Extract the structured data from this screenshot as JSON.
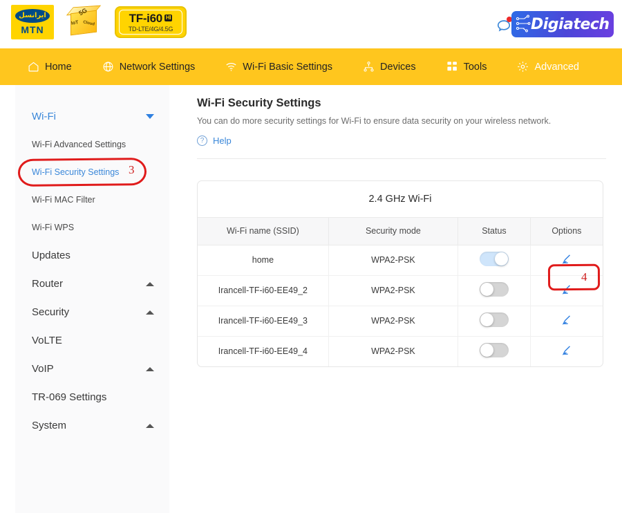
{
  "brand": {
    "irancell_fa": "ایرانسل",
    "mtn": "MTN",
    "cube": {
      "g5": "5G",
      "iot": "IoT",
      "cloud": "Cloud"
    },
    "device_model": "TF-i60",
    "device_badge": "HI",
    "device_tech": "TD-LTE/4G/4.5G",
    "vendor": "Digiatech",
    "chat_icon": "chat-bubble-icon",
    "chat_badge_icon": "notification-dot-icon"
  },
  "nav": {
    "items": [
      {
        "label": "Home",
        "icon": "home-icon",
        "active": false
      },
      {
        "label": "Network Settings",
        "icon": "globe-icon",
        "active": false
      },
      {
        "label": "Wi-Fi Basic Settings",
        "icon": "wifi-icon",
        "active": false
      },
      {
        "label": "Devices",
        "icon": "devices-tree-icon",
        "active": false
      },
      {
        "label": "Tools",
        "icon": "grid-squares-icon",
        "active": false
      },
      {
        "label": "Advanced",
        "icon": "gear-icon",
        "active": true
      }
    ]
  },
  "sidebar": {
    "groups": [
      {
        "label": "Wi-Fi",
        "expanded": true,
        "caret": "chevron-down-icon",
        "children": [
          {
            "label": "Wi-Fi Advanced Settings",
            "active": false
          },
          {
            "label": "Wi-Fi Security Settings",
            "active": true
          },
          {
            "label": "Wi-Fi MAC Filter",
            "active": false
          },
          {
            "label": "Wi-Fi WPS",
            "active": false
          }
        ]
      },
      {
        "label": "Updates",
        "expanded": false,
        "caret": ""
      },
      {
        "label": "Router",
        "expanded": false,
        "caret": "chevron-up-icon"
      },
      {
        "label": "Security",
        "expanded": false,
        "caret": "chevron-up-icon"
      },
      {
        "label": "VoLTE",
        "expanded": false,
        "caret": ""
      },
      {
        "label": "VoIP",
        "expanded": false,
        "caret": "chevron-up-icon"
      },
      {
        "label": "TR-069 Settings",
        "expanded": false,
        "caret": ""
      },
      {
        "label": "System",
        "expanded": false,
        "caret": "chevron-up-icon"
      }
    ]
  },
  "main": {
    "title": "Wi-Fi Security Settings",
    "description": "You can do more security settings for Wi-Fi to ensure data security on your wireless network.",
    "help_label": "Help",
    "help_icon": "question-mark-circle-icon"
  },
  "table": {
    "band_title": "2.4 GHz Wi-Fi",
    "headers": [
      "Wi-Fi name (SSID)",
      "Security mode",
      "Status",
      "Options"
    ],
    "rows": [
      {
        "ssid": "home",
        "mode": "WPA2-PSK",
        "status": "on",
        "edit_icon": "pencil-edit-icon"
      },
      {
        "ssid": "Irancell-TF-i60-EE49_2",
        "mode": "WPA2-PSK",
        "status": "off",
        "edit_icon": "pencil-edit-icon"
      },
      {
        "ssid": "Irancell-TF-i60-EE49_3",
        "mode": "WPA2-PSK",
        "status": "off",
        "edit_icon": "pencil-edit-icon"
      },
      {
        "ssid": "Irancell-TF-i60-EE49_4",
        "mode": "WPA2-PSK",
        "status": "off",
        "edit_icon": "pencil-edit-icon"
      }
    ]
  },
  "annotations": {
    "step3": "3",
    "step4": "4",
    "color": "#cf2020"
  },
  "colors": {
    "nav_bg": "#FFC61E",
    "brand_yellow": "#FFD400",
    "link_blue": "#3a87d9",
    "toggle_on": "#cfe5fb",
    "toggle_off": "#d5d5d5",
    "annotation_red": "#e01b1b"
  }
}
